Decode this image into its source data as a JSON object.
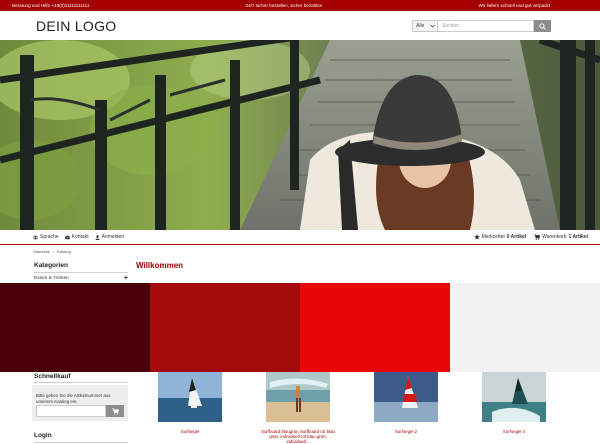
{
  "topbar": {
    "left": "Beratung und Hilfe +49(0)11111111111",
    "center": "24/7 sicher bestellen, sicher bezahlen",
    "right": "Wir liefern schnell und gut verpackt"
  },
  "header": {
    "logo": "DEIN LOGO",
    "search_select": "Alle",
    "search_placeholder": "Suchen"
  },
  "nav": {
    "left": [
      {
        "label": "Sprache",
        "icon": "globe-icon"
      },
      {
        "label": "Kontakt",
        "icon": "phone-icon"
      },
      {
        "label": "Anmelden",
        "icon": "user-icon"
      }
    ],
    "merkzettel_label": "Merkzettel",
    "merkzettel_count": "0 Artikel",
    "warenkorb_label": "Warenkorb",
    "warenkorb_count": "1 Artikel"
  },
  "breadcrumb": {
    "home": "Startseite",
    "sep": "›",
    "current": "Katalog"
  },
  "page_title": "Willkommen",
  "sidebar": {
    "categories_heading": "Kategorien",
    "category_item": "Essen & Trinken",
    "quick_heading": "Schnellkauf",
    "quick_text": "Bitte geben Sie die Artikelnummer aus unserem Katalog ein.",
    "login_heading": "Login"
  },
  "swatch_colors": [
    "#4a0008",
    "#a30a0c",
    "#e80808",
    "#f2f2f2"
  ],
  "products": [
    {
      "name": "Surfsegel"
    },
    {
      "name": "Surfboard blaugrün Surfboard rot blau grün, individuell rot blau grün, individuell..."
    },
    {
      "name": "Surfsegel 2"
    },
    {
      "name": "Surfsegel 4"
    }
  ],
  "accent_color": "#a40000"
}
